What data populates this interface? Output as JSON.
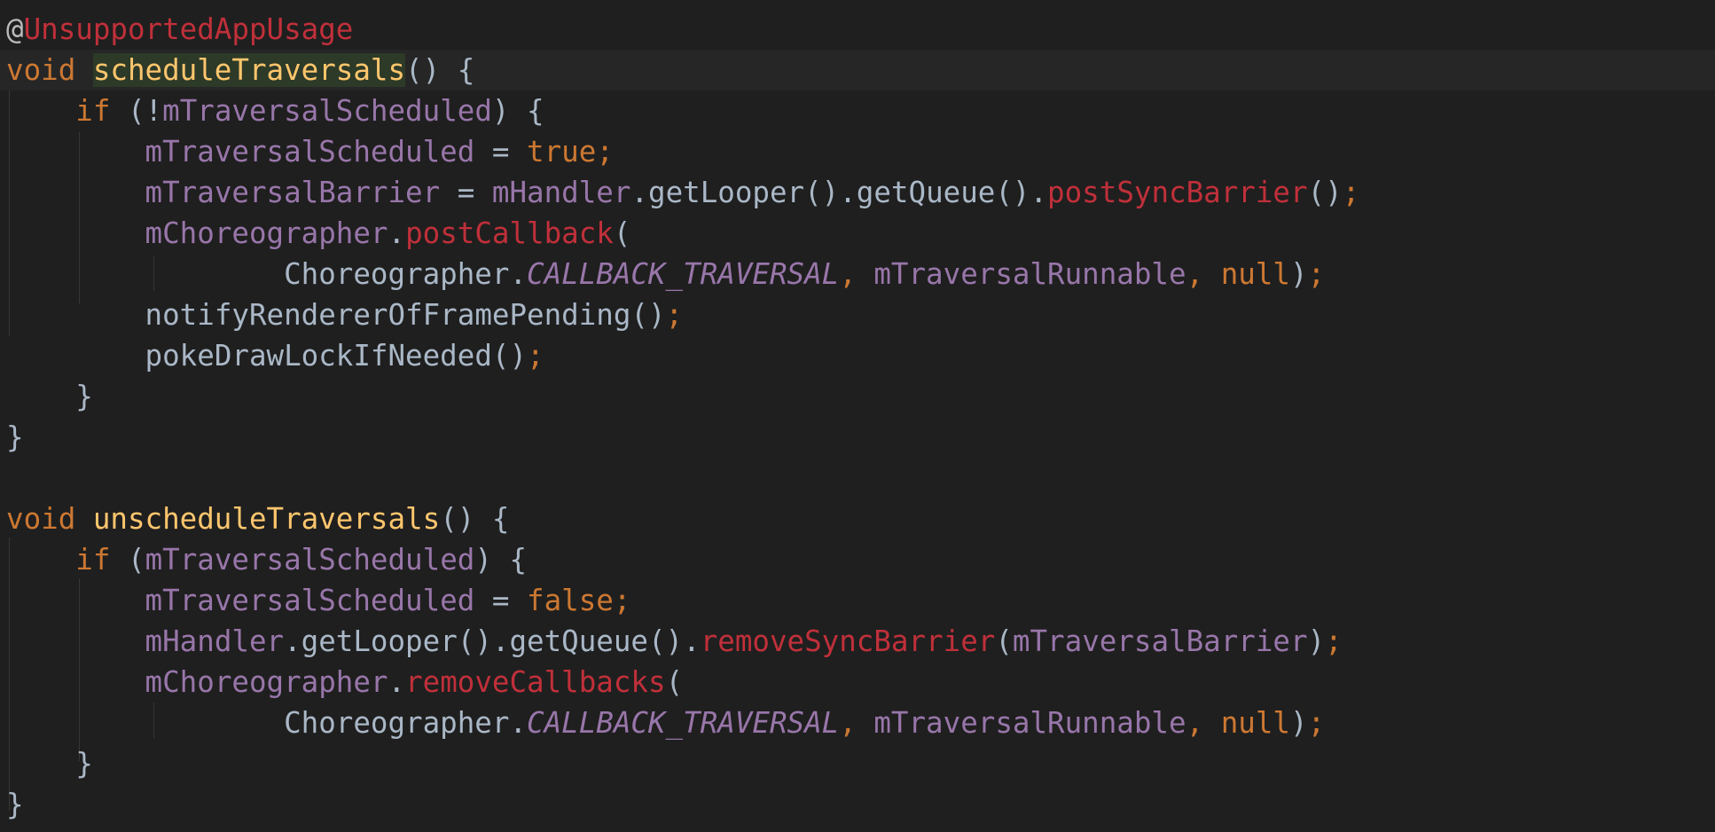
{
  "editor": {
    "lines": [
      {
        "tokens": [
          {
            "t": "@",
            "c": "at"
          },
          {
            "t": "UnsupportedAppUsage",
            "c": "ann"
          }
        ]
      },
      {
        "tokens": [
          {
            "t": "void ",
            "c": "kw"
          },
          {
            "t": "scheduleTraversals",
            "c": "fn"
          },
          {
            "t": "() {",
            "c": "pl"
          }
        ],
        "current": true
      },
      {
        "tokens": [
          {
            "t": "    "
          },
          {
            "t": "if ",
            "c": "kw"
          },
          {
            "t": "(!",
            "c": "pl"
          },
          {
            "t": "mTraversalScheduled",
            "c": "fld"
          },
          {
            "t": ") {",
            "c": "pl"
          }
        ]
      },
      {
        "tokens": [
          {
            "t": "        "
          },
          {
            "t": "mTraversalScheduled",
            "c": "fld"
          },
          {
            "t": " = ",
            "c": "pl"
          },
          {
            "t": "true",
            "c": "kw"
          },
          {
            "t": ";",
            "c": "op"
          }
        ]
      },
      {
        "tokens": [
          {
            "t": "        "
          },
          {
            "t": "mTraversalBarrier",
            "c": "fld"
          },
          {
            "t": " = ",
            "c": "pl"
          },
          {
            "t": "mHandler",
            "c": "fld"
          },
          {
            "t": ".getLooper().getQueue().",
            "c": "pl"
          },
          {
            "t": "postSyncBarrier",
            "c": "red"
          },
          {
            "t": "()",
            "c": "pl"
          },
          {
            "t": ";",
            "c": "op"
          }
        ]
      },
      {
        "tokens": [
          {
            "t": "        "
          },
          {
            "t": "mChoreographer",
            "c": "fld"
          },
          {
            "t": ".",
            "c": "pl"
          },
          {
            "t": "postCallback",
            "c": "red"
          },
          {
            "t": "(",
            "c": "pl"
          }
        ]
      },
      {
        "tokens": [
          {
            "t": "                "
          },
          {
            "t": "Choreographer.",
            "c": "pl"
          },
          {
            "t": "CALLBACK_TRAVERSAL",
            "c": "ifld"
          },
          {
            "t": ", ",
            "c": "op"
          },
          {
            "t": "mTraversalRunnable",
            "c": "fld"
          },
          {
            "t": ", ",
            "c": "op"
          },
          {
            "t": "null",
            "c": "kw"
          },
          {
            "t": ")",
            "c": "pl"
          },
          {
            "t": ";",
            "c": "op"
          }
        ]
      },
      {
        "tokens": [
          {
            "t": "        "
          },
          {
            "t": "notifyRendererOfFramePending()",
            "c": "pl"
          },
          {
            "t": ";",
            "c": "op"
          }
        ]
      },
      {
        "tokens": [
          {
            "t": "        "
          },
          {
            "t": "pokeDrawLockIfNeeded()",
            "c": "pl"
          },
          {
            "t": ";",
            "c": "op"
          }
        ]
      },
      {
        "tokens": [
          {
            "t": "    "
          },
          {
            "t": "}",
            "c": "pl"
          }
        ]
      },
      {
        "tokens": [
          {
            "t": "}",
            "c": "pl"
          }
        ]
      },
      {
        "tokens": []
      },
      {
        "tokens": [
          {
            "t": "void ",
            "c": "kw"
          },
          {
            "t": "unscheduleTraversals",
            "c": "fn"
          },
          {
            "t": "() {",
            "c": "pl"
          }
        ]
      },
      {
        "tokens": [
          {
            "t": "    "
          },
          {
            "t": "if ",
            "c": "kw"
          },
          {
            "t": "(",
            "c": "pl"
          },
          {
            "t": "mTraversalScheduled",
            "c": "fld"
          },
          {
            "t": ") {",
            "c": "pl"
          }
        ]
      },
      {
        "tokens": [
          {
            "t": "        "
          },
          {
            "t": "mTraversalScheduled",
            "c": "fld"
          },
          {
            "t": " = ",
            "c": "pl"
          },
          {
            "t": "false",
            "c": "kw"
          },
          {
            "t": ";",
            "c": "op"
          }
        ]
      },
      {
        "tokens": [
          {
            "t": "        "
          },
          {
            "t": "mHandler",
            "c": "fld"
          },
          {
            "t": ".getLooper().getQueue().",
            "c": "pl"
          },
          {
            "t": "removeSyncBarrier",
            "c": "red"
          },
          {
            "t": "(",
            "c": "pl"
          },
          {
            "t": "mTraversalBarrier",
            "c": "fld"
          },
          {
            "t": ")",
            "c": "pl"
          },
          {
            "t": ";",
            "c": "op"
          }
        ]
      },
      {
        "tokens": [
          {
            "t": "        "
          },
          {
            "t": "mChoreographer",
            "c": "fld"
          },
          {
            "t": ".",
            "c": "pl"
          },
          {
            "t": "removeCallbacks",
            "c": "red"
          },
          {
            "t": "(",
            "c": "pl"
          }
        ]
      },
      {
        "tokens": [
          {
            "t": "                "
          },
          {
            "t": "Choreographer.",
            "c": "pl"
          },
          {
            "t": "CALLBACK_TRAVERSAL",
            "c": "ifld"
          },
          {
            "t": ", ",
            "c": "op"
          },
          {
            "t": "mTraversalRunnable",
            "c": "fld"
          },
          {
            "t": ", ",
            "c": "op"
          },
          {
            "t": "null",
            "c": "kw"
          },
          {
            "t": ")",
            "c": "pl"
          },
          {
            "t": ";",
            "c": "op"
          }
        ]
      },
      {
        "tokens": [
          {
            "t": "    "
          },
          {
            "t": "}",
            "c": "pl"
          }
        ]
      },
      {
        "tokens": [
          {
            "t": "}",
            "c": "pl"
          }
        ]
      }
    ]
  },
  "colors": {
    "background": "#1f1f1f",
    "current_line": "#262626",
    "keyword": "#cc7832",
    "function": "#ffc66d",
    "field": "#9876aa",
    "annotation": "#c0303a",
    "plain": "#a9b7c6"
  }
}
